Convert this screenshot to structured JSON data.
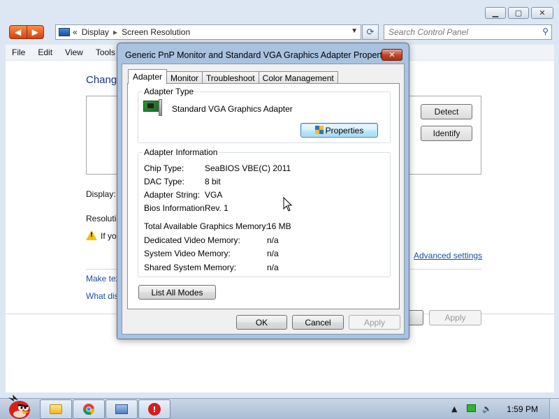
{
  "window": {
    "address": {
      "overflow": "«",
      "crumb1": "Display",
      "crumb2": "Screen Resolution"
    },
    "search_placeholder": "Search Control Panel",
    "menu": [
      "File",
      "Edit",
      "View",
      "Tools"
    ],
    "heading": "Chang",
    "detect_label": "Detect",
    "identify_label": "Identify",
    "display_label": "Display:",
    "resolution_label": "Resolutio",
    "warning_text": "If yo",
    "advanced_link": "Advanced settings",
    "link1": "Make tex",
    "link2": "What dis",
    "apply_label": "Apply"
  },
  "dialog": {
    "title": "Generic PnP Monitor and Standard VGA Graphics Adapter Properties",
    "close_glyph": "✕",
    "tabs": [
      "Adapter",
      "Monitor",
      "Troubleshoot",
      "Color Management"
    ],
    "adapter_type": {
      "legend": "Adapter Type",
      "name": "Standard VGA Graphics Adapter",
      "properties_label": "Properties"
    },
    "adapter_info": {
      "legend": "Adapter Information",
      "rows": [
        {
          "label": "Chip Type:",
          "value": "SeaBIOS VBE(C) 2011"
        },
        {
          "label": "DAC Type:",
          "value": "8 bit"
        },
        {
          "label": "Adapter String:",
          "value": "VGA"
        },
        {
          "label": "Bios Information:",
          "value": "Rev. 1"
        }
      ],
      "memory": [
        {
          "label": "Total Available Graphics Memory:",
          "value": "16 MB"
        },
        {
          "label": "Dedicated Video Memory:",
          "value": "n/a"
        },
        {
          "label": "System Video Memory:",
          "value": "n/a"
        },
        {
          "label": "Shared System Memory:",
          "value": "n/a"
        }
      ]
    },
    "list_all_modes_label": "List All Modes",
    "ok_label": "OK",
    "cancel_label": "Cancel",
    "apply_label": "Apply"
  },
  "taskbar": {
    "clock": "1:59 PM"
  },
  "icons": {
    "back": "back-arrow-icon",
    "forward": "forward-arrow-icon",
    "refresh": "refresh-icon",
    "search": "search-icon",
    "shield": "uac-shield-icon",
    "card": "video-card-icon",
    "warning": "warning-icon"
  },
  "colors": {
    "link": "#1e4da3",
    "heading": "#1e3287",
    "dialog_frame": "#a9c2df",
    "close_button": "#c2412a"
  }
}
